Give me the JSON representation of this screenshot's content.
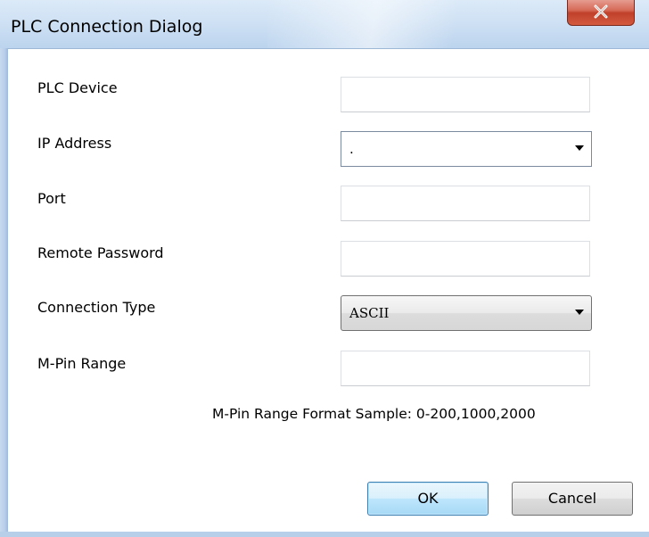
{
  "window": {
    "title": "PLC Connection Dialog"
  },
  "fields": {
    "plc_device": {
      "label": "PLC Device",
      "value": ""
    },
    "ip_address": {
      "label": "IP Address",
      "value": "."
    },
    "port": {
      "label": "Port",
      "value": ""
    },
    "remote_password": {
      "label": "Remote Password",
      "value": ""
    },
    "connection_type": {
      "label": "Connection Type",
      "value": "ASCII"
    },
    "m_pin_range": {
      "label": "M-Pin Range",
      "value": ""
    }
  },
  "hint": "M-Pin Range Format Sample: 0-200,1000,2000",
  "buttons": {
    "ok": "OK",
    "cancel": "Cancel"
  },
  "icons": {
    "close": "close-icon",
    "dropdown": "chevron-down-icon"
  },
  "colors": {
    "close_button": "#c0402a",
    "default_button_border": "#3c7fb1"
  }
}
